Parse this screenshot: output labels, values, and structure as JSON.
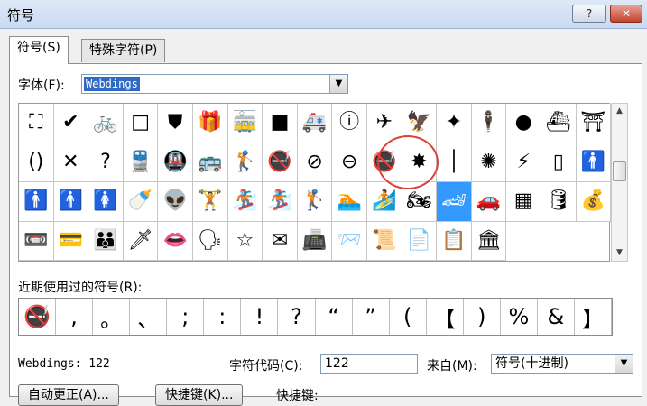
{
  "window": {
    "title": "符号",
    "help_label": "?",
    "close_label": "✕"
  },
  "tabs": [
    {
      "label": "符号(S)"
    },
    {
      "label": "特殊字符(P)"
    }
  ],
  "font": {
    "label": "字体(F):",
    "value": "Webdings"
  },
  "grid": {
    "columns": 17,
    "selected_index": 46,
    "symbols": [
      "⛶",
      "✔",
      "🚲",
      "□",
      "⛊",
      "🎁",
      "🚋",
      "■",
      "🚑",
      "ⓘ",
      "✈",
      "🦅",
      "✦",
      "🕴",
      "●",
      "⛴",
      "⛩",
      "()",
      "✕",
      "?",
      "🚆",
      "🚇",
      "🚌",
      "🏌",
      "🚭",
      "⊘",
      "⊖",
      "🚭",
      "✸",
      "│",
      "✺",
      "⚡",
      "▯",
      "🚹",
      "🚹",
      "🚹",
      "🚺",
      "🍼",
      "👽",
      "🏋",
      "🏂",
      "🏂",
      "🏌",
      "🏊",
      "🏄",
      "🏍",
      "🏎",
      "🚗",
      "▦",
      "🛢",
      "💰",
      "📼",
      "💳",
      "👪",
      "🗡",
      "👄",
      "🗣",
      "☆",
      "✉",
      "📠",
      "📨",
      "📜",
      "📄",
      "📋",
      "🏛"
    ]
  },
  "recent": {
    "label": "近期使用过的符号(R):",
    "symbols": [
      "🚭",
      ",",
      "。",
      "、",
      ";",
      ":",
      "!",
      "?",
      "“",
      "”",
      "(",
      "【",
      ")",
      "%",
      "&",
      "】"
    ]
  },
  "footer": {
    "font_code": "Webdings: 122",
    "code_label": "字符代码(C):",
    "code_value": "122",
    "from_label": "来自(M):",
    "from_value": "符号(十进制)",
    "autocorrect_label": "自动更正(A)...",
    "shortcut_button_label": "快捷键(K)...",
    "shortcut_label": "快捷键:"
  }
}
